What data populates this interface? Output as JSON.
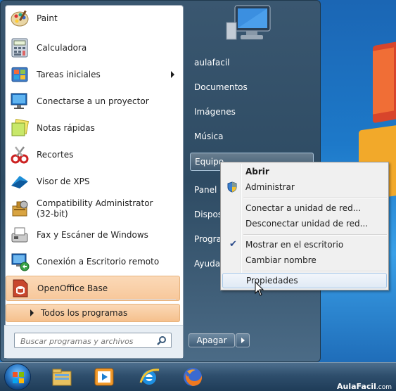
{
  "start_menu": {
    "programs": [
      {
        "label": "Paint",
        "icon": "paint-icon"
      },
      {
        "label": "Calculadora",
        "icon": "calculator-icon"
      },
      {
        "label": "Tareas iniciales",
        "icon": "getting-started-icon",
        "submenu": true
      },
      {
        "label": "Conectarse a un proyector",
        "icon": "projector-icon"
      },
      {
        "label": "Notas rápidas",
        "icon": "sticky-notes-icon"
      },
      {
        "label": "Recortes",
        "icon": "snipping-tool-icon"
      },
      {
        "label": "Visor de XPS",
        "icon": "xps-viewer-icon"
      },
      {
        "label": "Compatibility Administrator",
        "label2": "(32-bit)",
        "icon": "compatibility-admin-icon"
      },
      {
        "label": "Fax y Escáner de Windows",
        "icon": "fax-scan-icon"
      },
      {
        "label": "Conexión a Escritorio remoto",
        "icon": "remote-desktop-icon"
      },
      {
        "label": "OpenOffice Base",
        "icon": "openoffice-base-icon",
        "highlighted": true
      }
    ],
    "all_programs_label": "Todos los programas",
    "search_placeholder": "Buscar programas y archivos",
    "right_items": [
      {
        "label": "aulafacil"
      },
      {
        "label": "Documentos"
      },
      {
        "label": "Imágenes"
      },
      {
        "label": "Música"
      },
      {
        "label": "Equipo",
        "selected": true
      },
      {
        "label": "Panel d"
      },
      {
        "label": "Disposi"
      },
      {
        "label": "Program"
      },
      {
        "label": "Ayuda y"
      }
    ],
    "shutdown_label": "Apagar"
  },
  "context_menu": {
    "items": [
      {
        "label": "Abrir",
        "bold": true
      },
      {
        "label": "Administrar",
        "icon": "shield-icon"
      },
      {
        "label": "Conectar a unidad de red..."
      },
      {
        "label": "Desconectar unidad de red..."
      },
      {
        "label": "Mostrar en el escritorio",
        "checked": true
      },
      {
        "label": "Cambiar nombre"
      },
      {
        "label": "Propiedades",
        "hover": true
      }
    ]
  },
  "taskbar": {
    "apps": [
      "explorer-icon",
      "media-player-icon",
      "internet-explorer-icon",
      "firefox-icon"
    ]
  },
  "watermark": {
    "brand": "AulaFacil",
    "suffix": ".com"
  },
  "colors": {
    "highlight": "#f7c79a",
    "menu_frame": "#2e4b63",
    "accent": "#1f6fb8"
  }
}
